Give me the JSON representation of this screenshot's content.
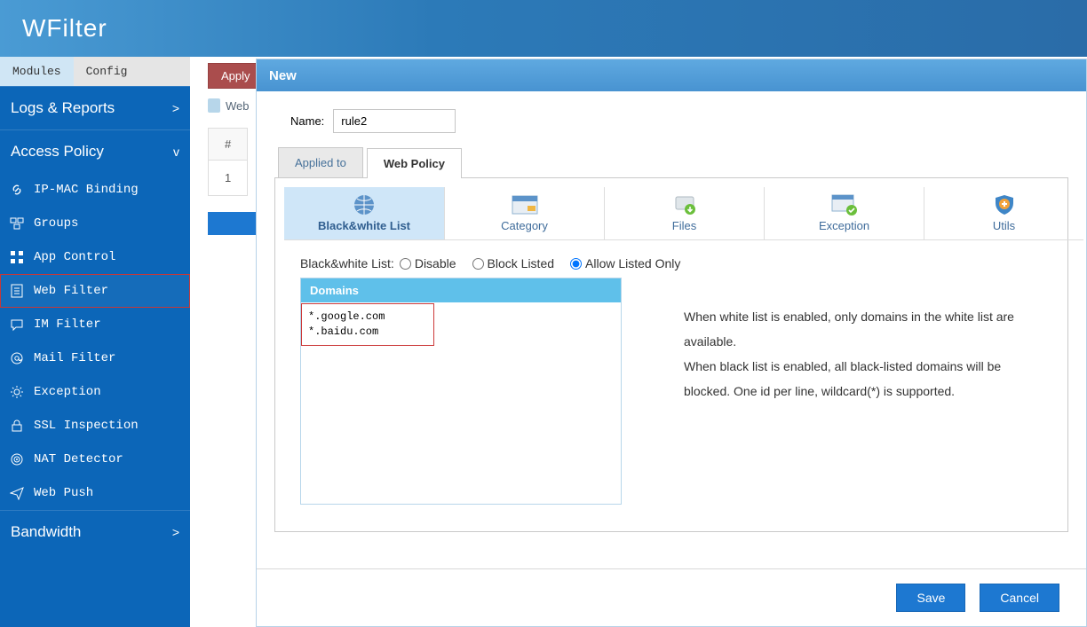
{
  "header": {
    "logo": "WFilter"
  },
  "sidebar": {
    "tabs": {
      "modules": "Modules",
      "config": "Config"
    },
    "sections": {
      "logs": {
        "label": "Logs & Reports",
        "chev": ">"
      },
      "access": {
        "label": "Access Policy",
        "chev": "v"
      },
      "bandwidth": {
        "label": "Bandwidth",
        "chev": ">"
      }
    },
    "items": [
      {
        "label": "IP-MAC Binding",
        "icon": "link-icon"
      },
      {
        "label": "Groups",
        "icon": "groups-icon"
      },
      {
        "label": "App Control",
        "icon": "grid-icon"
      },
      {
        "label": "Web Filter",
        "icon": "page-icon",
        "highlighted": true
      },
      {
        "label": "IM Filter",
        "icon": "chat-icon"
      },
      {
        "label": "Mail Filter",
        "icon": "at-icon"
      },
      {
        "label": "Exception",
        "icon": "gear-icon"
      },
      {
        "label": "SSL Inspection",
        "icon": "lock-icon"
      },
      {
        "label": "NAT Detector",
        "icon": "radar-icon"
      },
      {
        "label": "Web Push",
        "icon": "send-icon"
      }
    ]
  },
  "back": {
    "apply": "Apply",
    "wf": "Web",
    "thead": "#",
    "tcell": "1"
  },
  "panel": {
    "title": "New",
    "nameLabel": "Name:",
    "nameValue": "rule2",
    "innerTabs": {
      "applied": "Applied to",
      "policy": "Web Policy"
    },
    "policyTabs": {
      "bw": "Black&white List",
      "cat": "Category",
      "files": "Files",
      "exc": "Exception",
      "utils": "Utils"
    },
    "bwLabel": "Black&white List:",
    "radios": {
      "disable": "Disable",
      "block": "Block Listed",
      "allow": "Allow Listed Only"
    },
    "domainsTitle": "Domains",
    "domainsValue": "*.google.com\n*.baidu.com",
    "hint1": "When white list is enabled, only domains in the white list are available.",
    "hint2": "When black list is enabled, all black-listed domains will be blocked. One id per line, wildcard(*) is supported.",
    "save": "Save",
    "cancel": "Cancel"
  }
}
